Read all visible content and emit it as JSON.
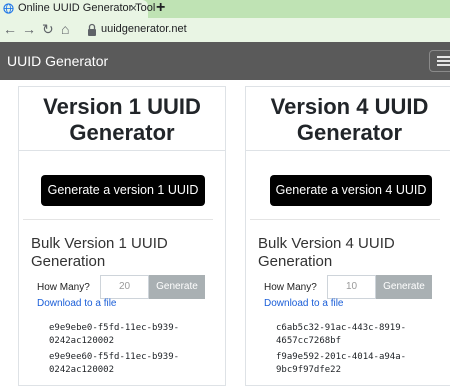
{
  "browser": {
    "tab_title": "Online UUID Generator Tool",
    "tab_close": "×",
    "new_tab": "+",
    "url": "uuidgenerator.net"
  },
  "navbar": {
    "brand": "UUID Generator"
  },
  "cards": [
    {
      "title_line1": "Version 1 UUID",
      "title_line2": "Generator",
      "generate_button": "Generate a version 1 UUID",
      "bulk_title": "Bulk Version 1 UUID Generation",
      "how_many_label": "How Many?",
      "how_many_value": "20",
      "bulk_generate_button": "Generate",
      "download_link": "Download to a file",
      "uuids": [
        {
          "line1": "e9e9ebe0-f5fd-11ec-b939-",
          "line2": "0242ac120002"
        },
        {
          "line1": "e9e9ee60-f5fd-11ec-b939-",
          "line2": "0242ac120002"
        }
      ]
    },
    {
      "title_line1": "Version 4 UUID",
      "title_line2": "Generator",
      "generate_button": "Generate a version 4 UUID",
      "bulk_title": "Bulk Version 4 UUID Generation",
      "how_many_label": "How Many?",
      "how_many_value": "10",
      "bulk_generate_button": "Generate",
      "download_link": "Download to a file",
      "uuids": [
        {
          "line1": "c6ab5c32-91ac-443c-8919-",
          "line2": "4657cc7268bf"
        },
        {
          "line1": "f9a9e592-201c-4014-a94a-",
          "line2": "9bc9f97dfe22"
        }
      ]
    }
  ],
  "icons": [
    "favicon-globe-icon",
    "back-arrow-icon",
    "forward-arrow-icon",
    "reload-icon",
    "home-icon",
    "lock-icon",
    "hamburger-menu-icon"
  ],
  "colors": {
    "navbar": "#5a5a5a",
    "primary_button": "#000000",
    "secondary_button": "#a9b0b3",
    "link": "#1a5ed8",
    "tab_strip": "#bfe3b4"
  }
}
